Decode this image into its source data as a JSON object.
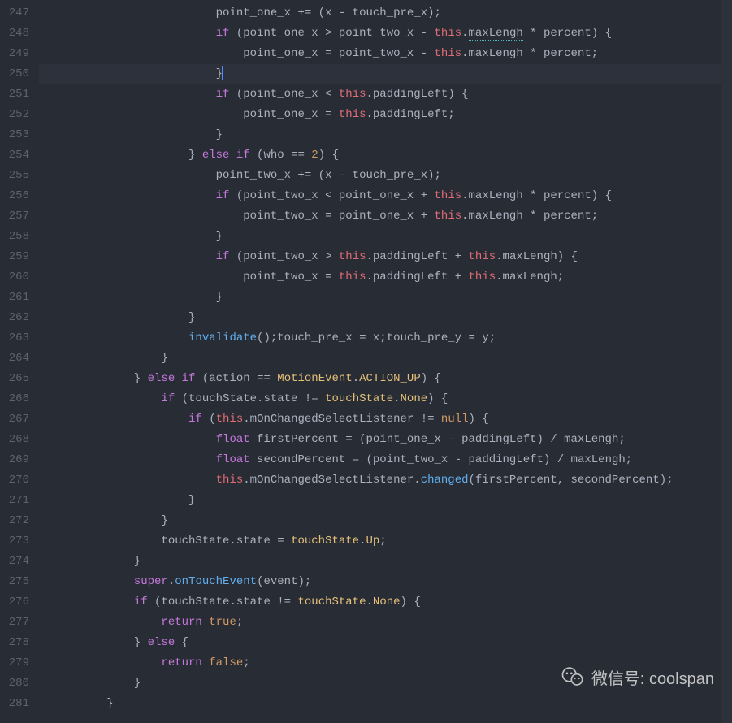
{
  "editor": {
    "startLine": 247,
    "highlightLine": 250,
    "lines": [
      {
        "indent": 24,
        "tokens": [
          {
            "t": "point_one_x ",
            "c": "default"
          },
          {
            "t": "+=",
            "c": "default"
          },
          {
            "t": " (x ",
            "c": "default"
          },
          {
            "t": "-",
            "c": "default"
          },
          {
            "t": " touch_pre_x);",
            "c": "default"
          }
        ]
      },
      {
        "indent": 24,
        "tokens": [
          {
            "t": "if",
            "c": "kw"
          },
          {
            "t": " (point_one_x ",
            "c": "default"
          },
          {
            "t": ">",
            "c": "default"
          },
          {
            "t": " point_two_x ",
            "c": "default"
          },
          {
            "t": "-",
            "c": "default"
          },
          {
            "t": " ",
            "c": "default"
          },
          {
            "t": "this",
            "c": "this"
          },
          {
            "t": ".",
            "c": "default"
          },
          {
            "t": "maxLengh",
            "c": "default",
            "squiggle": true
          },
          {
            "t": " ",
            "c": "default"
          },
          {
            "t": "*",
            "c": "default"
          },
          {
            "t": " percent) {",
            "c": "default"
          }
        ]
      },
      {
        "indent": 28,
        "tokens": [
          {
            "t": "point_one_x ",
            "c": "default"
          },
          {
            "t": "=",
            "c": "default"
          },
          {
            "t": " point_two_x ",
            "c": "default"
          },
          {
            "t": "-",
            "c": "default"
          },
          {
            "t": " ",
            "c": "default"
          },
          {
            "t": "this",
            "c": "this"
          },
          {
            "t": ".maxLengh ",
            "c": "default"
          },
          {
            "t": "*",
            "c": "default"
          },
          {
            "t": " percent;",
            "c": "default"
          }
        ]
      },
      {
        "indent": 24,
        "tokens": [
          {
            "t": "}",
            "c": "default"
          }
        ],
        "cursor": true
      },
      {
        "indent": 24,
        "tokens": [
          {
            "t": "if",
            "c": "kw"
          },
          {
            "t": " (point_one_x ",
            "c": "default"
          },
          {
            "t": "<",
            "c": "default"
          },
          {
            "t": " ",
            "c": "default"
          },
          {
            "t": "this",
            "c": "this"
          },
          {
            "t": ".paddingLeft) {",
            "c": "default"
          }
        ]
      },
      {
        "indent": 28,
        "tokens": [
          {
            "t": "point_one_x ",
            "c": "default"
          },
          {
            "t": "=",
            "c": "default"
          },
          {
            "t": " ",
            "c": "default"
          },
          {
            "t": "this",
            "c": "this"
          },
          {
            "t": ".paddingLeft;",
            "c": "default"
          }
        ]
      },
      {
        "indent": 24,
        "tokens": [
          {
            "t": "}",
            "c": "default"
          }
        ]
      },
      {
        "indent": 20,
        "tokens": [
          {
            "t": "}",
            "c": "default"
          },
          {
            "t": " ",
            "c": "default"
          },
          {
            "t": "else if",
            "c": "kw"
          },
          {
            "t": " (who ",
            "c": "default"
          },
          {
            "t": "==",
            "c": "default"
          },
          {
            "t": " ",
            "c": "default"
          },
          {
            "t": "2",
            "c": "num"
          },
          {
            "t": ") {",
            "c": "default"
          }
        ]
      },
      {
        "indent": 24,
        "tokens": [
          {
            "t": "point_two_x ",
            "c": "default"
          },
          {
            "t": "+=",
            "c": "default"
          },
          {
            "t": " (x ",
            "c": "default"
          },
          {
            "t": "-",
            "c": "default"
          },
          {
            "t": " touch_pre_x);",
            "c": "default"
          }
        ]
      },
      {
        "indent": 24,
        "tokens": [
          {
            "t": "if",
            "c": "kw"
          },
          {
            "t": " (point_two_x ",
            "c": "default"
          },
          {
            "t": "<",
            "c": "default"
          },
          {
            "t": " point_one_x ",
            "c": "default"
          },
          {
            "t": "+",
            "c": "default"
          },
          {
            "t": " ",
            "c": "default"
          },
          {
            "t": "this",
            "c": "this"
          },
          {
            "t": ".maxLengh ",
            "c": "default"
          },
          {
            "t": "*",
            "c": "default"
          },
          {
            "t": " percent) {",
            "c": "default"
          }
        ]
      },
      {
        "indent": 28,
        "tokens": [
          {
            "t": "point_two_x ",
            "c": "default"
          },
          {
            "t": "=",
            "c": "default"
          },
          {
            "t": " point_one_x ",
            "c": "default"
          },
          {
            "t": "+",
            "c": "default"
          },
          {
            "t": " ",
            "c": "default"
          },
          {
            "t": "this",
            "c": "this"
          },
          {
            "t": ".maxLengh ",
            "c": "default"
          },
          {
            "t": "*",
            "c": "default"
          },
          {
            "t": " percent;",
            "c": "default"
          }
        ]
      },
      {
        "indent": 24,
        "tokens": [
          {
            "t": "}",
            "c": "default"
          }
        ]
      },
      {
        "indent": 24,
        "tokens": [
          {
            "t": "if",
            "c": "kw"
          },
          {
            "t": " (point_two_x ",
            "c": "default"
          },
          {
            "t": ">",
            "c": "default"
          },
          {
            "t": " ",
            "c": "default"
          },
          {
            "t": "this",
            "c": "this"
          },
          {
            "t": ".paddingLeft ",
            "c": "default"
          },
          {
            "t": "+",
            "c": "default"
          },
          {
            "t": " ",
            "c": "default"
          },
          {
            "t": "this",
            "c": "this"
          },
          {
            "t": ".maxLengh) {",
            "c": "default"
          }
        ]
      },
      {
        "indent": 28,
        "tokens": [
          {
            "t": "point_two_x ",
            "c": "default"
          },
          {
            "t": "=",
            "c": "default"
          },
          {
            "t": " ",
            "c": "default"
          },
          {
            "t": "this",
            "c": "this"
          },
          {
            "t": ".paddingLeft ",
            "c": "default"
          },
          {
            "t": "+",
            "c": "default"
          },
          {
            "t": " ",
            "c": "default"
          },
          {
            "t": "this",
            "c": "this"
          },
          {
            "t": ".maxLengh;",
            "c": "default"
          }
        ]
      },
      {
        "indent": 24,
        "tokens": [
          {
            "t": "}",
            "c": "default"
          }
        ]
      },
      {
        "indent": 20,
        "tokens": [
          {
            "t": "}",
            "c": "default"
          }
        ]
      },
      {
        "indent": 20,
        "tokens": [
          {
            "t": "invalidate",
            "c": "fn"
          },
          {
            "t": "();touch_pre_x ",
            "c": "default"
          },
          {
            "t": "=",
            "c": "default"
          },
          {
            "t": " x;touch_pre_y ",
            "c": "default"
          },
          {
            "t": "=",
            "c": "default"
          },
          {
            "t": " y;",
            "c": "default"
          }
        ]
      },
      {
        "indent": 16,
        "tokens": [
          {
            "t": "}",
            "c": "default"
          }
        ]
      },
      {
        "indent": 12,
        "tokens": [
          {
            "t": "}",
            "c": "default"
          },
          {
            "t": " ",
            "c": "default"
          },
          {
            "t": "else if",
            "c": "kw"
          },
          {
            "t": " (action ",
            "c": "default"
          },
          {
            "t": "==",
            "c": "default"
          },
          {
            "t": " ",
            "c": "default"
          },
          {
            "t": "MotionEvent",
            "c": "obj"
          },
          {
            "t": ".",
            "c": "default"
          },
          {
            "t": "ACTION_UP",
            "c": "field"
          },
          {
            "t": ") {",
            "c": "default"
          }
        ]
      },
      {
        "indent": 16,
        "tokens": [
          {
            "t": "if",
            "c": "kw"
          },
          {
            "t": " (touchState.state ",
            "c": "default"
          },
          {
            "t": "!=",
            "c": "default"
          },
          {
            "t": " ",
            "c": "default"
          },
          {
            "t": "touchState",
            "c": "obj"
          },
          {
            "t": ".",
            "c": "default"
          },
          {
            "t": "None",
            "c": "field"
          },
          {
            "t": ") {",
            "c": "default"
          }
        ]
      },
      {
        "indent": 20,
        "tokens": [
          {
            "t": "if",
            "c": "kw"
          },
          {
            "t": " (",
            "c": "default"
          },
          {
            "t": "this",
            "c": "this"
          },
          {
            "t": ".mOnChangedSelectListener ",
            "c": "default"
          },
          {
            "t": "!=",
            "c": "default"
          },
          {
            "t": " ",
            "c": "default"
          },
          {
            "t": "null",
            "c": "const"
          },
          {
            "t": ") {",
            "c": "default"
          }
        ]
      },
      {
        "indent": 24,
        "tokens": [
          {
            "t": "float",
            "c": "kw"
          },
          {
            "t": " firstPercent ",
            "c": "default"
          },
          {
            "t": "=",
            "c": "default"
          },
          {
            "t": " (point_one_x ",
            "c": "default"
          },
          {
            "t": "-",
            "c": "default"
          },
          {
            "t": " paddingLeft) ",
            "c": "default"
          },
          {
            "t": "/",
            "c": "default"
          },
          {
            "t": " maxLengh;",
            "c": "default"
          }
        ]
      },
      {
        "indent": 24,
        "tokens": [
          {
            "t": "float",
            "c": "kw"
          },
          {
            "t": " secondPercent ",
            "c": "default"
          },
          {
            "t": "=",
            "c": "default"
          },
          {
            "t": " (point_two_x ",
            "c": "default"
          },
          {
            "t": "-",
            "c": "default"
          },
          {
            "t": " paddingLeft) ",
            "c": "default"
          },
          {
            "t": "/",
            "c": "default"
          },
          {
            "t": " maxLengh;",
            "c": "default"
          }
        ]
      },
      {
        "indent": 24,
        "tokens": [
          {
            "t": "this",
            "c": "this"
          },
          {
            "t": ".mOnChangedSelectListener.",
            "c": "default"
          },
          {
            "t": "changed",
            "c": "fn"
          },
          {
            "t": "(firstPercent, secondPercent);",
            "c": "default"
          }
        ]
      },
      {
        "indent": 20,
        "tokens": [
          {
            "t": "}",
            "c": "default"
          }
        ]
      },
      {
        "indent": 16,
        "tokens": [
          {
            "t": "}",
            "c": "default"
          }
        ]
      },
      {
        "indent": 16,
        "tokens": [
          {
            "t": "touchState.state ",
            "c": "default"
          },
          {
            "t": "=",
            "c": "default"
          },
          {
            "t": " ",
            "c": "default"
          },
          {
            "t": "touchState",
            "c": "obj"
          },
          {
            "t": ".",
            "c": "default"
          },
          {
            "t": "Up",
            "c": "field"
          },
          {
            "t": ";",
            "c": "default"
          }
        ]
      },
      {
        "indent": 12,
        "tokens": [
          {
            "t": "}",
            "c": "default"
          }
        ]
      },
      {
        "indent": 12,
        "tokens": [
          {
            "t": "super",
            "c": "kw"
          },
          {
            "t": ".",
            "c": "default"
          },
          {
            "t": "onTouchEvent",
            "c": "fn"
          },
          {
            "t": "(event);",
            "c": "default"
          }
        ]
      },
      {
        "indent": 12,
        "tokens": [
          {
            "t": "if",
            "c": "kw"
          },
          {
            "t": " (touchState.state ",
            "c": "default"
          },
          {
            "t": "!=",
            "c": "default"
          },
          {
            "t": " ",
            "c": "default"
          },
          {
            "t": "touchState",
            "c": "obj"
          },
          {
            "t": ".",
            "c": "default"
          },
          {
            "t": "None",
            "c": "field"
          },
          {
            "t": ") {",
            "c": "default"
          }
        ]
      },
      {
        "indent": 16,
        "tokens": [
          {
            "t": "return",
            "c": "kw"
          },
          {
            "t": " ",
            "c": "default"
          },
          {
            "t": "true",
            "c": "const"
          },
          {
            "t": ";",
            "c": "default"
          }
        ]
      },
      {
        "indent": 12,
        "tokens": [
          {
            "t": "}",
            "c": "default"
          },
          {
            "t": " ",
            "c": "default"
          },
          {
            "t": "else",
            "c": "kw"
          },
          {
            "t": " {",
            "c": "default"
          }
        ]
      },
      {
        "indent": 16,
        "tokens": [
          {
            "t": "return",
            "c": "kw"
          },
          {
            "t": " ",
            "c": "default"
          },
          {
            "t": "false",
            "c": "const"
          },
          {
            "t": ";",
            "c": "default"
          }
        ]
      },
      {
        "indent": 12,
        "tokens": [
          {
            "t": "}",
            "c": "default"
          }
        ]
      },
      {
        "indent": 8,
        "tokens": [
          {
            "t": "}",
            "c": "default"
          }
        ]
      }
    ]
  },
  "watermark": {
    "label": "微信号:",
    "value": "coolspan"
  }
}
